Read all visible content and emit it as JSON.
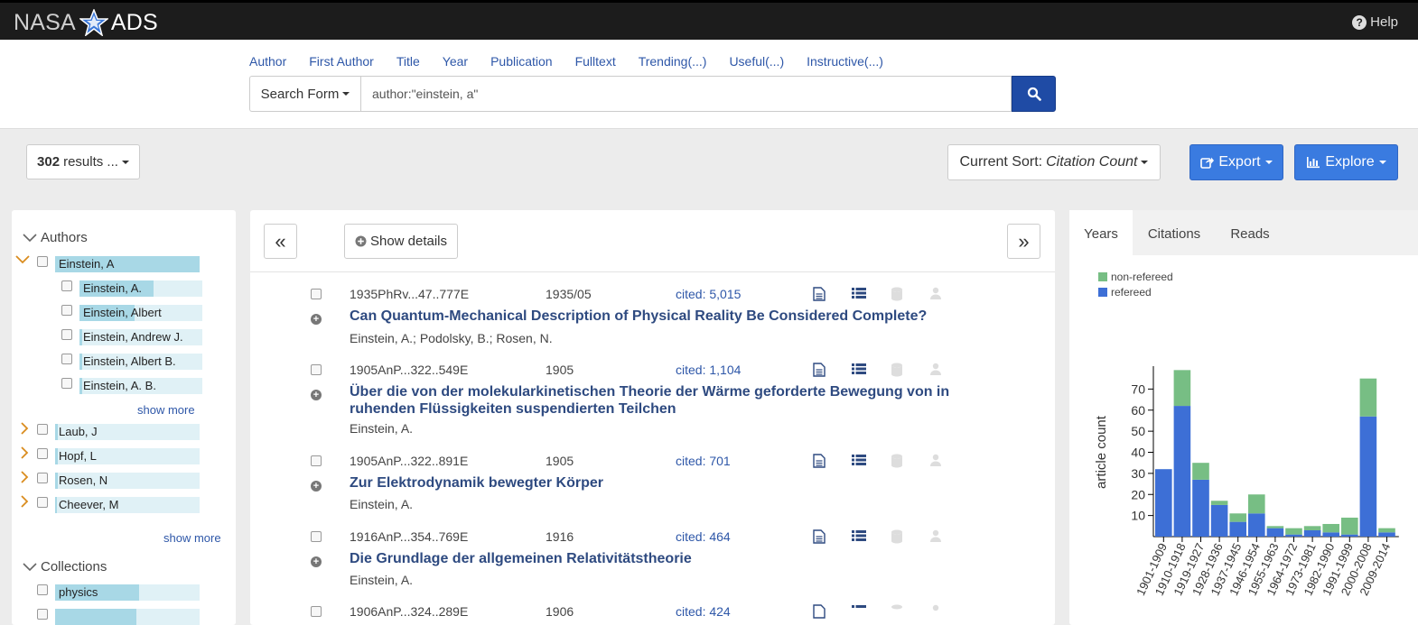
{
  "app": {
    "brand_left": "NASA",
    "brand_right": "ADS",
    "help": "Help"
  },
  "search": {
    "quick_links": [
      "Author",
      "First Author",
      "Title",
      "Year",
      "Publication",
      "Fulltext",
      "Trending(...)",
      "Useful(...)",
      "Instructive(...)"
    ],
    "form_label": "Search Form",
    "query": "author:\"einstein, a\""
  },
  "toolbar": {
    "results_count": "302",
    "results_suffix": "results ...",
    "sort_prefix": "Current Sort:",
    "sort_value": "Citation Count",
    "export": "Export",
    "explore": "Explore"
  },
  "facets": {
    "authors_title": "Authors",
    "authors": [
      {
        "label": "Einstein, A",
        "fill": 1.0
      },
      {
        "label": "Laub, J",
        "fill": 0.02
      },
      {
        "label": "Hopf, L",
        "fill": 0.02
      },
      {
        "label": "Rosen, N",
        "fill": 0.02
      },
      {
        "label": "Cheever, M",
        "fill": 0.01
      }
    ],
    "sub_authors": [
      {
        "label": "Einstein, A.",
        "fill": 0.6
      },
      {
        "label": "Einstein, Albert",
        "fill": 0.45
      },
      {
        "label": "Einstein, Andrew J.",
        "fill": 0.02
      },
      {
        "label": "Einstein, Albert B.",
        "fill": 0.02
      },
      {
        "label": "Einstein, A. B.",
        "fill": 0.02
      }
    ],
    "show_more_sub": "show more",
    "show_more": "show more",
    "collections_title": "Collections",
    "collections": [
      {
        "label": "physics",
        "fill": 0.58
      }
    ]
  },
  "pager": {
    "prev": "«",
    "next": "»",
    "show_details": "Show details"
  },
  "results": [
    {
      "bibcode": "1935PhRv...47..777E",
      "date": "1935/05",
      "cited": "cited: 5,015",
      "title": "Can Quantum-Mechanical Description of Physical Reality Be Considered Complete?",
      "authors": "Einstein, A.;  Podolsky, B.;  Rosen, N."
    },
    {
      "bibcode": "1905AnP...322..549E",
      "date": "1905",
      "cited": "cited: 1,104",
      "title": "Über die von der molekularkinetischen Theorie der Wärme geforderte Bewegung von in ruhenden Flüssigkeiten suspendierten Teilchen",
      "authors": "Einstein, A."
    },
    {
      "bibcode": "1905AnP...322..891E",
      "date": "1905",
      "cited": "cited: 701",
      "title": "Zur Elektrodynamik bewegter Körper",
      "authors": "Einstein, A."
    },
    {
      "bibcode": "1916AnP...354..769E",
      "date": "1916",
      "cited": "cited: 464",
      "title": "Die Grundlage der allgemeinen Relativitätstheorie",
      "authors": "Einstein, A."
    },
    {
      "bibcode": "1906AnP...324..289E",
      "date": "1906",
      "cited": "cited: 424",
      "title": "",
      "authors": ""
    }
  ],
  "right_tabs": [
    "Years",
    "Citations",
    "Reads"
  ],
  "colors": {
    "refereed": "#3d6fd6",
    "non_refereed": "#77be84",
    "accent": "#3a7be0",
    "link": "#2e57a8"
  },
  "chart_data": {
    "type": "bar",
    "ylabel": "article count",
    "xlabel": "",
    "ylim": [
      0,
      80
    ],
    "yticks": [
      10,
      20,
      30,
      40,
      50,
      60,
      70
    ],
    "categories": [
      "1901-1909",
      "1910-1918",
      "1919-1927",
      "1928-1936",
      "1937-1945",
      "1946-1954",
      "1955-1963",
      "1964-1972",
      "1973-1981",
      "1982-1990",
      "1991-1999",
      "2000-2008",
      "2009-2014"
    ],
    "series": [
      {
        "name": "refereed",
        "values": [
          32,
          62,
          27,
          15,
          7,
          11,
          4,
          1,
          3,
          2,
          1,
          57,
          2
        ]
      },
      {
        "name": "non-refereed",
        "values": [
          0,
          17,
          8,
          2,
          4,
          9,
          1,
          3,
          2,
          4,
          8,
          18,
          2
        ]
      }
    ],
    "stacked": true,
    "legend": "top-left"
  }
}
